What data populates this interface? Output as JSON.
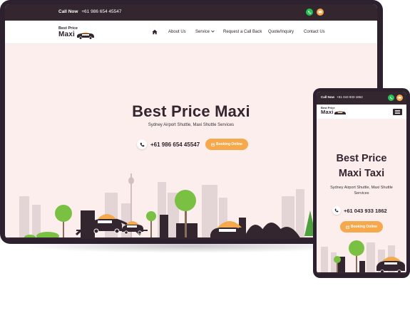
{
  "desktop": {
    "topbar": {
      "call_label": "Call Now",
      "phone": "+61 986 654 45547"
    },
    "logo": {
      "line1": "Best Price",
      "line2": "Maxi"
    },
    "nav": {
      "items": [
        "About Us",
        "Service",
        "Request a Call Back",
        "Quote/Inquiry",
        "Contact Us"
      ]
    },
    "hero": {
      "title": "Best Price Maxi",
      "subtitle": "Sydney Airport Shuttle, Maxi Shuttle Services",
      "phone": "+61 986 654 45547",
      "button_label": "Booking Online"
    }
  },
  "mobile": {
    "topbar": {
      "call_label": "Call Now",
      "phone": "+61 043 933 1862"
    },
    "logo": {
      "line1": "Best Price",
      "line2": "Maxi"
    },
    "hero": {
      "title_line1": "Best Price",
      "title_line2": "Maxi Taxi",
      "subtitle": "Sydney Airport Shuttle, Maxi Shuttle Services",
      "phone": "+61 043 933 1862",
      "button_label": "Booking Online"
    }
  },
  "colors": {
    "dark": "#33262f",
    "accent": "#f6a84c",
    "whatsapp": "#25c254",
    "chat": "#f6a84c",
    "hero_bg": "#fdeeee",
    "tree_green": "#7ac143"
  },
  "icons": [
    "whatsapp-icon",
    "chat-icon",
    "home-icon",
    "chevron-down-icon",
    "phone-icon",
    "calendar-icon",
    "menu-icon"
  ]
}
